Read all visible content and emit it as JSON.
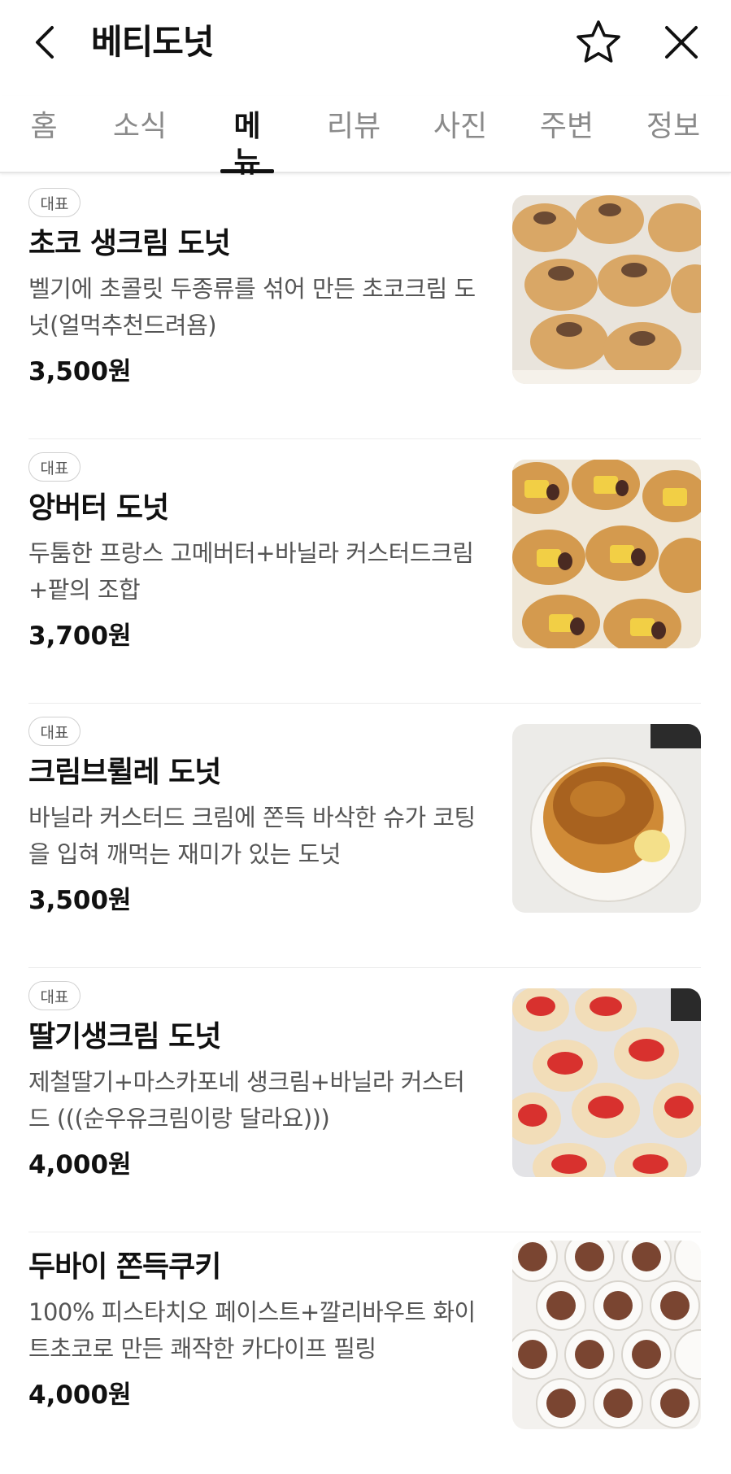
{
  "header": {
    "title": "베티도넛"
  },
  "tabs": [
    {
      "label": "홈",
      "active": false
    },
    {
      "label": "소식",
      "active": false
    },
    {
      "label": "메뉴",
      "active": true
    },
    {
      "label": "리뷰",
      "active": false
    },
    {
      "label": "사진",
      "active": false
    },
    {
      "label": "주변",
      "active": false
    },
    {
      "label": "정보",
      "active": false
    }
  ],
  "menu": [
    {
      "badge": "대표",
      "name": "초코 생크림 도넛",
      "description": "벨기에 초콜릿 두종류를 섞어 만든 초코크림 도넛(얼먹추천드려욤)",
      "price": "3,500원"
    },
    {
      "badge": "대표",
      "name": "앙버터 도넛",
      "description": "두툼한 프랑스 고메버터+바닐라 커스터드크림+팥의 조합",
      "price": "3,700원"
    },
    {
      "badge": "대표",
      "name": "크림브륄레 도넛",
      "description": "바닐라 커스터드 크림에 쫀득 바삭한 슈가 코팅을 입혀 깨먹는 재미가 있는 도넛",
      "price": "3,500원"
    },
    {
      "badge": "대표",
      "name": "딸기생크림 도넛",
      "description": "제철딸기+마스카포네 생크림+바닐라 커스터드 (((순우유크림이랑 달라요)))",
      "price": "4,000원"
    },
    {
      "badge": "",
      "name": "두바이 쫀득쿠키",
      "description": "100% 피스타치오 페이스트+깔리바우트 화이트초코로 만든 쾌작한 카다이프 필링",
      "price": "4,000원"
    }
  ],
  "icons": {
    "back": "chevron-left-icon",
    "favorite": "star-outline-icon",
    "close": "close-icon"
  },
  "colors": {
    "text_primary": "#111111",
    "text_secondary": "#555555",
    "tab_inactive": "#8a8a8a",
    "divider": "#ececec"
  }
}
